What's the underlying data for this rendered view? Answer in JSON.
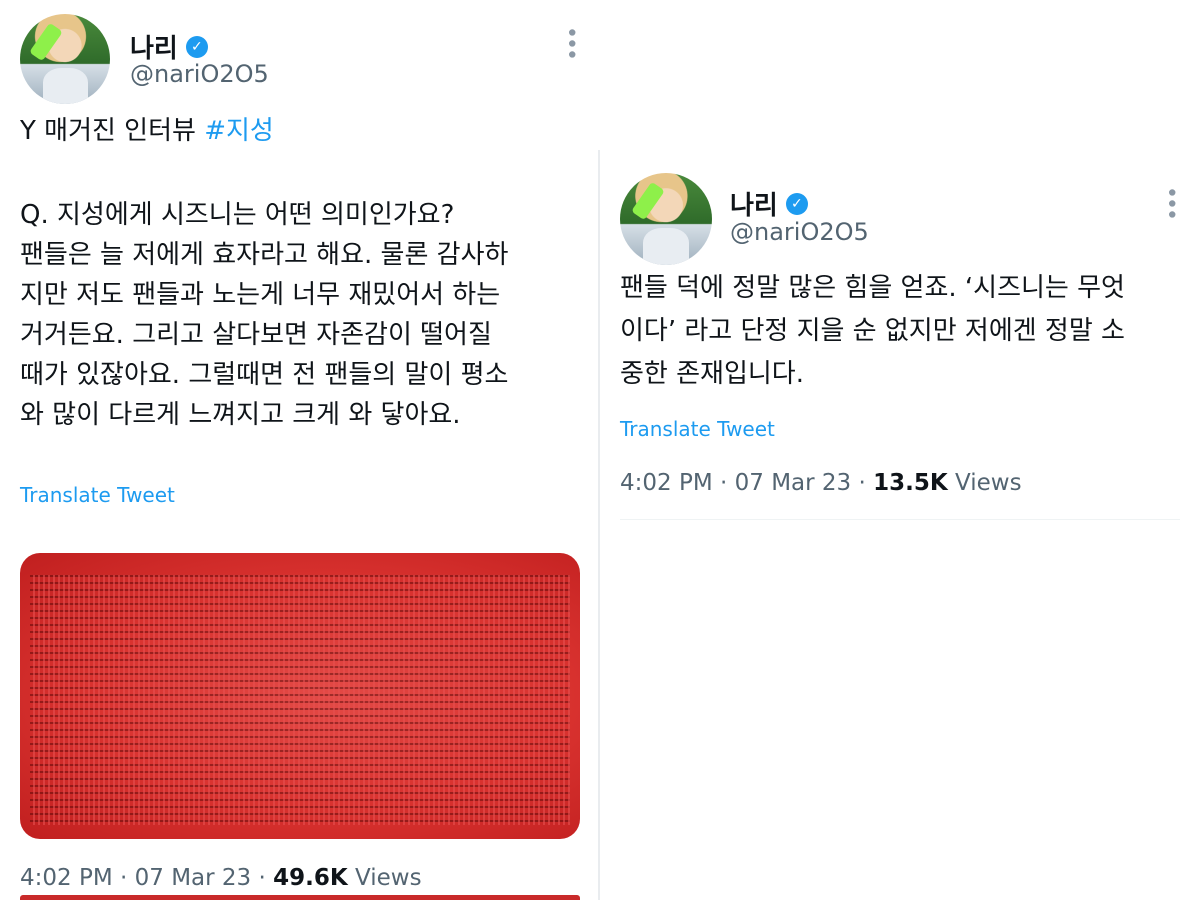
{
  "left_tweet": {
    "author_name": "나리",
    "handle": "@nariO2O5",
    "text_prefix": "Y 매거진 인터뷰 ",
    "hashtag": "#지성",
    "body": "Q. 지성에게 시즈니는 어떤 의미인가요?\n팬들은 늘 저에게 효자라고 해요. 물론 감사하\n지만 저도 팬들과 노는게 너무 재밌어서 하는\n거거든요. 그리고 살다보면 자존감이 떨어질\n때가 있잖아요. 그럴때면 전 팬들의 말이 평소\n와 많이 다르게 느껴지고 크게 와 닿아요.",
    "translate_label": "Translate Tweet",
    "time": "4:02 PM",
    "date": "07 Mar 23",
    "views_count": "49.6K",
    "views_label": "Views"
  },
  "right_tweet": {
    "author_name": "나리",
    "handle": "@nariO2O5",
    "body": "팬들 덕에 정말 많은 힘을 얻죠. ‘시즈니는 무엇\n이다’ 라고 단정 지을 순 없지만 저에겐 정말 소\n중한 존재입니다.",
    "translate_label": "Translate Tweet",
    "time": "4:02 PM",
    "date": "07 Mar 23",
    "views_count": "13.5K",
    "views_label": "Views"
  },
  "separator": " · ",
  "colors": {
    "accent": "#1d9bf0",
    "secondary_text": "#536471",
    "media_red": "#d9322f"
  },
  "icons": {
    "verified": "verified-badge-icon",
    "more": "more-options-icon"
  }
}
